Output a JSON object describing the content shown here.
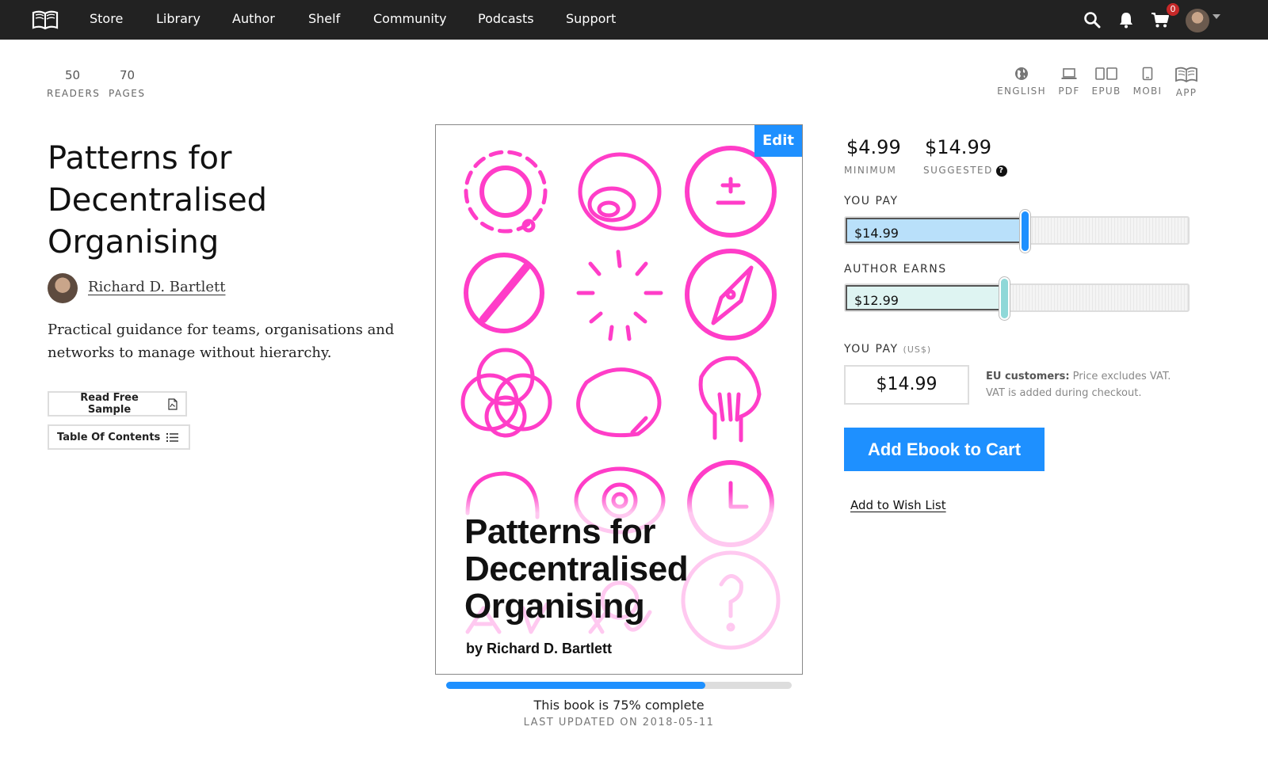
{
  "nav": {
    "items": [
      "Store",
      "Library",
      "Author",
      "Shelf",
      "Community",
      "Podcasts",
      "Support"
    ],
    "icons": [
      "search-icon",
      "bell-icon",
      "cart-icon"
    ],
    "cart_count": "0"
  },
  "stats": {
    "readers_value": "50",
    "readers_label": "READERS",
    "pages_value": "70",
    "pages_label": "PAGES"
  },
  "formats": [
    {
      "label": "ENGLISH",
      "icon": "globe-icon"
    },
    {
      "label": "PDF",
      "icon": "laptop-icon"
    },
    {
      "label": "EPUB",
      "icon": "tablets-icon"
    },
    {
      "label": "MOBI",
      "icon": "ereader-icon"
    },
    {
      "label": "APP",
      "icon": "open-book-icon"
    }
  ],
  "book": {
    "title_line1": "Patterns for",
    "title_line2": "Decentralised",
    "title_line3": "Organising",
    "author": "Richard D. Bartlett",
    "blurb": "Practical guidance for teams, organisations and networks to manage without hierarchy.",
    "read_sample": "Read Free Sample",
    "table_of_contents": "Table Of Contents"
  },
  "cover": {
    "edit_label": "Edit",
    "title_line1": "Patterns for",
    "title_line2": "Decentralised",
    "title_line3": "Organising",
    "byline": "by Richard D. Bartlett",
    "accent_color": "#ff3dc8"
  },
  "progress": {
    "percent": 75,
    "text": "This book is 75% complete",
    "updated": "LAST UPDATED ON 2018-05-11"
  },
  "pricing": {
    "minimum_value": "$4.99",
    "minimum_label": "MINIMUM",
    "suggested_value": "$14.99",
    "suggested_label": "SUGGESTED",
    "you_pay_label": "YOU PAY",
    "you_pay_slider_value": "$14.99",
    "you_pay_fraction": 0.52,
    "author_earns_label": "AUTHOR EARNS",
    "author_earns_value": "$12.99",
    "author_earns_fraction": 0.46,
    "you_pay_input_label": "YOU PAY",
    "currency_label": "(US$)",
    "you_pay_input_value": "$14.99",
    "eu_note_bold": "EU customers:",
    "eu_note_text": "Price excludes VAT. VAT is added during checkout.",
    "add_to_cart": "Add Ebook to Cart",
    "wishlist": "Add to Wish List",
    "you_pay_color": "#b9e0fa",
    "you_pay_thumb_color": "#1e90ff",
    "author_color": "#def4f2",
    "author_thumb_color": "#8fd8d8"
  },
  "colors": {
    "primary": "#1e90ff",
    "nav_bg": "#222222"
  }
}
